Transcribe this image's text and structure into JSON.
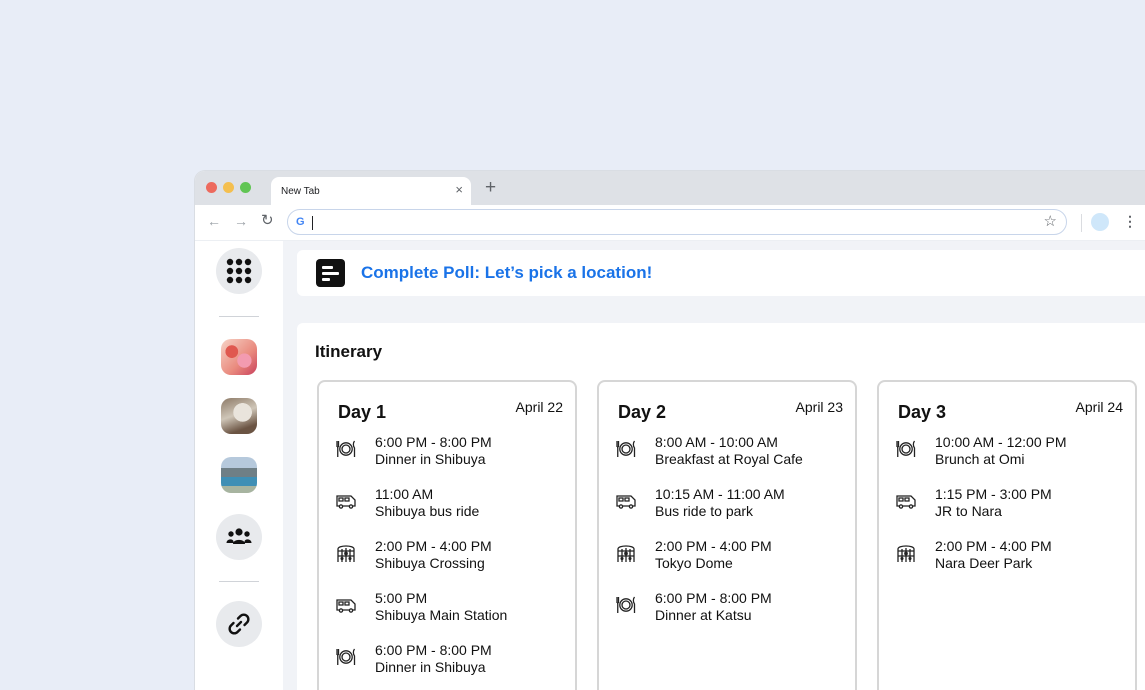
{
  "browser": {
    "tab_title": "New Tab",
    "tab_close": "×",
    "new_tab": "+",
    "back": "←",
    "forward": "→",
    "reload": "↻",
    "google_g": "G",
    "star": "☆",
    "menu": "⋮"
  },
  "rail": {
    "items": [
      {
        "name": "apps-grid-button",
        "icon": "grid-icon"
      },
      {
        "name": "thumbnail-1",
        "icon": "photo"
      },
      {
        "name": "thumbnail-2",
        "icon": "photo"
      },
      {
        "name": "thumbnail-3",
        "icon": "photo"
      },
      {
        "name": "group-button",
        "icon": "people-icon"
      },
      {
        "name": "link-button",
        "icon": "link-icon"
      }
    ]
  },
  "poll": {
    "text": "Complete Poll: Let’s pick a location!",
    "icon": "poll-icon",
    "color": "#1a73e8"
  },
  "itinerary": {
    "title": "Itinerary",
    "days": [
      {
        "name": "Day 1",
        "date": "April 22",
        "events": [
          {
            "time": "6:00 PM - 8:00 PM",
            "title": "Dinner in Shibuya",
            "icon": "dining-icon"
          },
          {
            "time": "11:00 AM",
            "title": "Shibuya bus ride",
            "icon": "bus-icon"
          },
          {
            "time": "2:00 PM - 4:00 PM",
            "title": "Shibuya Crossing",
            "icon": "sightseeing-icon"
          },
          {
            "time": "5:00 PM",
            "title": "Shibuya Main Station",
            "icon": "bus-icon"
          },
          {
            "time": "6:00 PM - 8:00 PM",
            "title": "Dinner in Shibuya",
            "icon": "dining-icon"
          }
        ]
      },
      {
        "name": "Day 2",
        "date": "April 23",
        "events": [
          {
            "time": "8:00 AM - 10:00 AM",
            "title": "Breakfast at Royal Cafe",
            "icon": "dining-icon"
          },
          {
            "time": "10:15 AM - 11:00 AM",
            "title": "Bus ride to park",
            "icon": "bus-icon"
          },
          {
            "time": "2:00 PM - 4:00 PM",
            "title": "Tokyo Dome",
            "icon": "sightseeing-icon"
          },
          {
            "time": "6:00 PM - 8:00 PM",
            "title": "Dinner at Katsu",
            "icon": "dining-icon"
          }
        ]
      },
      {
        "name": "Day 3",
        "date": "April 24",
        "events": [
          {
            "time": "10:00 AM - 12:00 PM",
            "title": "Brunch at Omi",
            "icon": "dining-icon"
          },
          {
            "time": "1:15 PM - 3:00 PM",
            "title": "JR to Nara",
            "icon": "bus-icon"
          },
          {
            "time": "2:00 PM - 4:00 PM",
            "title": "Nara Deer Park",
            "icon": "sightseeing-icon"
          }
        ]
      }
    ]
  }
}
